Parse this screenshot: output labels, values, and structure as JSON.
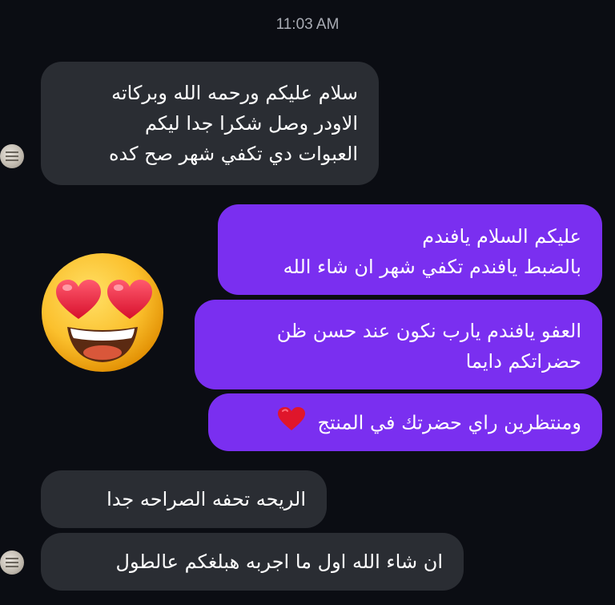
{
  "status": {
    "time": "11:03 AM"
  },
  "messages": [
    {
      "side": "in",
      "lines": [
        "سلام عليكم ورحمه الله وبركاته",
        "الاودر وصل شكرا جدا ليكم",
        "العبوات دي تكفي شهر صح كده"
      ]
    },
    {
      "side": "out",
      "lines": [
        "عليكم السلام يافندم",
        "بالضبط يافندم تكفي شهر ان شاء الله"
      ]
    },
    {
      "side": "out",
      "lines": [
        "العفو يافندم يارب نكون عند حسن ظن",
        "حضراتكم دايما"
      ]
    },
    {
      "side": "out",
      "lines": [
        "ومنتظرين راي حضرتك في المنتج"
      ],
      "emoji": "❤️"
    },
    {
      "side": "in",
      "lines": [
        "الريحه تحفه الصراحه جدا"
      ]
    },
    {
      "side": "in",
      "lines": [
        "ان شاء الله اول ما اجربه هبلغكم عالطول"
      ]
    }
  ],
  "reaction_sticker": "smiling-face-with-heart-eyes-icon",
  "colors": {
    "background": "#0b0d13",
    "incoming": "#2a2d33",
    "outgoing": "#7a2ff0"
  }
}
